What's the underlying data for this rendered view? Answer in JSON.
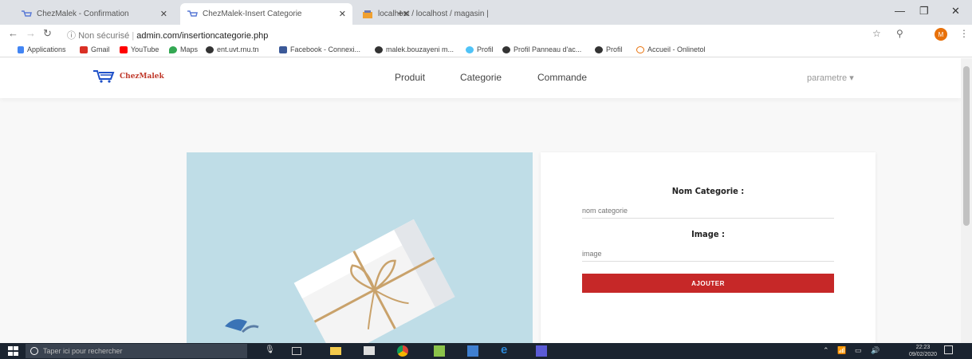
{
  "browser": {
    "tabs": [
      {
        "title": "ChezMalek - Confirmation"
      },
      {
        "title": "ChezMalek-Insert Categorie"
      },
      {
        "title": "localhost / localhost / magasin |"
      }
    ],
    "address": {
      "security": "Non sécurisé",
      "url": "admin.com/insertioncategorie.php"
    },
    "avatar_letter": "M",
    "bookmarks": [
      {
        "label": "Applications",
        "color": "#4285f4"
      },
      {
        "label": "Gmail",
        "color": "#d93025"
      },
      {
        "label": "YouTube",
        "color": "#ff0000"
      },
      {
        "label": "Maps",
        "color": "#34a853"
      },
      {
        "label": "ent.uvt.rnu.tn",
        "color": "#333333"
      },
      {
        "label": "Facebook - Connexi...",
        "color": "#3b5998"
      },
      {
        "label": "malek.bouzayeni m...",
        "color": "#333333"
      },
      {
        "label": "Profil",
        "color": "#4fc3f7"
      },
      {
        "label": "Profil Panneau d'ac...",
        "color": "#333333"
      },
      {
        "label": "Profil",
        "color": "#333333"
      },
      {
        "label": "Accueil - Onlinetol",
        "color": "#e8710a"
      }
    ]
  },
  "site": {
    "brand": "ChezMalek",
    "nav": [
      "Produit",
      "Categorie",
      "Commande"
    ],
    "settings_menu": "parametre ▾"
  },
  "form": {
    "category_label": "Nom Categorie :",
    "category_placeholder": "nom categorie",
    "image_label": "Image :",
    "image_placeholder": "image",
    "submit_label": "AJOUTER"
  },
  "taskbar": {
    "search_placeholder": "Taper ici pour rechercher",
    "time": "22:23",
    "date": "09/02/2020"
  },
  "colors": {
    "accent": "#c62828",
    "image_background": "#bfdde7",
    "taskbar": "#1b2430"
  }
}
